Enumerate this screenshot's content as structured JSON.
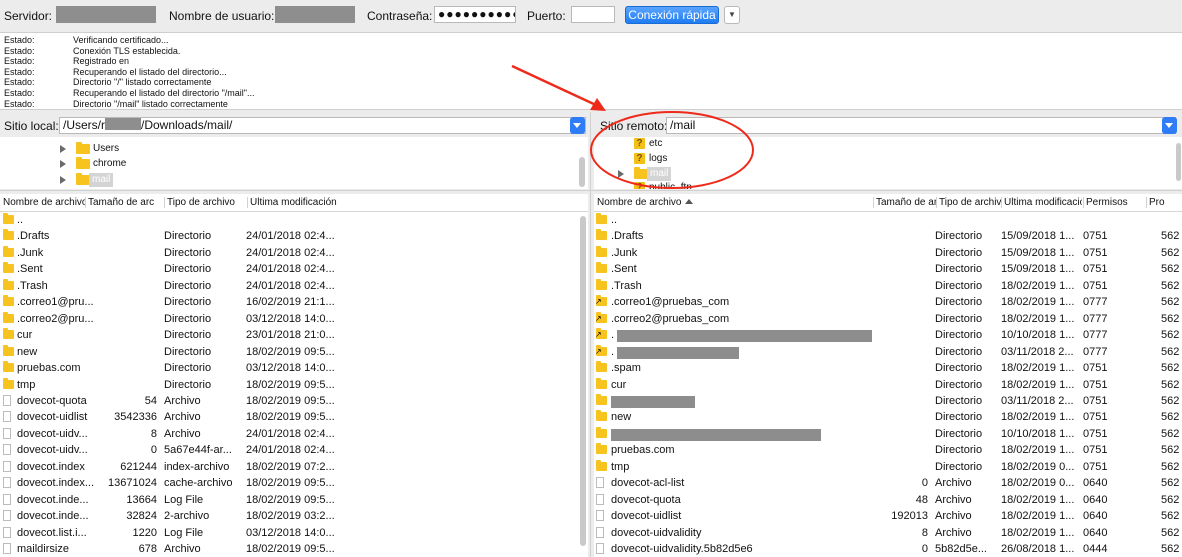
{
  "quickconnect": {
    "server_label": "Servidor:",
    "user_label": "Nombre de usuario:",
    "password_label": "Contraseña:",
    "password_value": "●●●●●●●●●●●",
    "port_label": "Puerto:",
    "port_value": "",
    "connect_button": "Conexión rápida",
    "dropdown_icon": "chevron-down-icon"
  },
  "log": [
    {
      "label": "Estado:",
      "msg": "Verificando certificado..."
    },
    {
      "label": "Estado:",
      "msg": "Conexión TLS establecida."
    },
    {
      "label": "Estado:",
      "msg": "Registrado en"
    },
    {
      "label": "Estado:",
      "msg": "Recuperando el listado del directorio..."
    },
    {
      "label": "Estado:",
      "msg": "Directorio \"/\" listado correctamente"
    },
    {
      "label": "Estado:",
      "msg": "Recuperando el listado del directorio \"/mail\"..."
    },
    {
      "label": "Estado:",
      "msg": "Directorio \"/mail\" listado correctamente"
    }
  ],
  "local": {
    "site_label": "Sitio local:",
    "path_start": "/Users/r",
    "path_end": "/Downloads/mail/",
    "tree": [
      "Users",
      "chrome",
      "mail"
    ],
    "headers": [
      "Nombre de archivo",
      "Tamaño de arc",
      "Tipo de archivo",
      "Última modificación"
    ],
    "rows": [
      {
        "name": "..",
        "size": "",
        "type": "",
        "mod": "",
        "kind": "folder"
      },
      {
        "name": ".Drafts",
        "size": "",
        "type": "Directorio",
        "mod": "24/01/2018 02:4...",
        "kind": "folder"
      },
      {
        "name": ".Junk",
        "size": "",
        "type": "Directorio",
        "mod": "24/01/2018 02:4...",
        "kind": "folder"
      },
      {
        "name": ".Sent",
        "size": "",
        "type": "Directorio",
        "mod": "24/01/2018 02:4...",
        "kind": "folder"
      },
      {
        "name": ".Trash",
        "size": "",
        "type": "Directorio",
        "mod": "24/01/2018 02:4...",
        "kind": "folder"
      },
      {
        "name": ".correo1@pru...",
        "size": "",
        "type": "Directorio",
        "mod": "16/02/2019 21:1...",
        "kind": "folder"
      },
      {
        "name": ".correo2@pru...",
        "size": "",
        "type": "Directorio",
        "mod": "03/12/2018 14:0...",
        "kind": "folder"
      },
      {
        "name": "cur",
        "size": "",
        "type": "Directorio",
        "mod": "23/01/2018 21:0...",
        "kind": "folder"
      },
      {
        "name": "new",
        "size": "",
        "type": "Directorio",
        "mod": "18/02/2019 09:5...",
        "kind": "folder"
      },
      {
        "name": "pruebas.com",
        "size": "",
        "type": "Directorio",
        "mod": "03/12/2018 14:0...",
        "kind": "folder"
      },
      {
        "name": "tmp",
        "size": "",
        "type": "Directorio",
        "mod": "18/02/2019 09:5...",
        "kind": "folder"
      },
      {
        "name": "dovecot-quota",
        "size": "54",
        "type": "Archivo",
        "mod": "18/02/2019 09:5...",
        "kind": "file"
      },
      {
        "name": "dovecot-uidlist",
        "size": "3542336",
        "type": "Archivo",
        "mod": "18/02/2019 09:5...",
        "kind": "file"
      },
      {
        "name": "dovecot-uidv...",
        "size": "8",
        "type": "Archivo",
        "mod": "24/01/2018 02:4...",
        "kind": "file"
      },
      {
        "name": "dovecot-uidv...",
        "size": "0",
        "type": "5a67e44f-ar...",
        "mod": "24/01/2018 02:4...",
        "kind": "file"
      },
      {
        "name": "dovecot.index",
        "size": "621244",
        "type": "index-archivo",
        "mod": "18/02/2019 07:2...",
        "kind": "file"
      },
      {
        "name": "dovecot.index...",
        "size": "13671024",
        "type": "cache-archivo",
        "mod": "18/02/2019 09:5...",
        "kind": "file"
      },
      {
        "name": "dovecot.inde...",
        "size": "13664",
        "type": "Log File",
        "mod": "18/02/2019 09:5...",
        "kind": "file"
      },
      {
        "name": "dovecot.inde...",
        "size": "32824",
        "type": "2-archivo",
        "mod": "18/02/2019 03:2...",
        "kind": "file"
      },
      {
        "name": "dovecot.list.i...",
        "size": "1220",
        "type": "Log File",
        "mod": "03/12/2018 14:0...",
        "kind": "file"
      },
      {
        "name": "maildirsize",
        "size": "678",
        "type": "Archivo",
        "mod": "18/02/2019 09:5...",
        "kind": "file"
      }
    ]
  },
  "remote": {
    "site_label": "Sitio remoto:",
    "path": "/mail",
    "tree": [
      "etc",
      "logs",
      "mail",
      "public_ftp"
    ],
    "headers": [
      "Nombre de archivo",
      "Tamaño de arc",
      "Tipo de archivo",
      "Última modificació",
      "Permisos",
      "Pro"
    ],
    "rows": [
      {
        "name": "..",
        "size": "",
        "type": "",
        "mod": "",
        "perm": "",
        "own": "",
        "kind": "folder"
      },
      {
        "name": ".Drafts",
        "size": "",
        "type": "Directorio",
        "mod": "15/09/2018 1...",
        "perm": "0751",
        "own": "562",
        "kind": "folder"
      },
      {
        "name": ".Junk",
        "size": "",
        "type": "Directorio",
        "mod": "15/09/2018 1...",
        "perm": "0751",
        "own": "562",
        "kind": "folder"
      },
      {
        "name": ".Sent",
        "size": "",
        "type": "Directorio",
        "mod": "15/09/2018 1...",
        "perm": "0751",
        "own": "562",
        "kind": "folder"
      },
      {
        "name": ".Trash",
        "size": "",
        "type": "Directorio",
        "mod": "18/02/2019 1...",
        "perm": "0751",
        "own": "562",
        "kind": "folder"
      },
      {
        "name": ".correo1@pruebas_com",
        "size": "",
        "type": "Directorio",
        "mod": "18/02/2019 1...",
        "perm": "0777",
        "own": "562",
        "kind": "link"
      },
      {
        "name": ".correo2@pruebas_com",
        "size": "",
        "type": "Directorio",
        "mod": "18/02/2019 1...",
        "perm": "0777",
        "own": "562",
        "kind": "link"
      },
      {
        "name": ".",
        "size": "",
        "type": "Directorio",
        "mod": "10/10/2018 1...",
        "perm": "0777",
        "own": "562",
        "kind": "link",
        "redact": 255
      },
      {
        "name": ".",
        "size": "",
        "type": "Directorio",
        "mod": "03/11/2018 2...",
        "perm": "0777",
        "own": "562",
        "kind": "link",
        "redact": 122
      },
      {
        "name": ".spam",
        "size": "",
        "type": "Directorio",
        "mod": "18/02/2019 1...",
        "perm": "0751",
        "own": "562",
        "kind": "folder"
      },
      {
        "name": "cur",
        "size": "",
        "type": "Directorio",
        "mod": "18/02/2019 1...",
        "perm": "0751",
        "own": "562",
        "kind": "folder"
      },
      {
        "name": "",
        "size": "",
        "type": "Directorio",
        "mod": "03/11/2018 2...",
        "perm": "0751",
        "own": "562",
        "kind": "folder",
        "redact": 84
      },
      {
        "name": "new",
        "size": "",
        "type": "Directorio",
        "mod": "18/02/2019 1...",
        "perm": "0751",
        "own": "562",
        "kind": "folder"
      },
      {
        "name": "",
        "size": "",
        "type": "Directorio",
        "mod": "10/10/2018 1...",
        "perm": "0751",
        "own": "562",
        "kind": "folder",
        "redact": 210
      },
      {
        "name": "pruebas.com",
        "size": "",
        "type": "Directorio",
        "mod": "18/02/2019 1...",
        "perm": "0751",
        "own": "562",
        "kind": "folder"
      },
      {
        "name": "tmp",
        "size": "",
        "type": "Directorio",
        "mod": "18/02/2019 0...",
        "perm": "0751",
        "own": "562",
        "kind": "folder"
      },
      {
        "name": "dovecot-acl-list",
        "size": "0",
        "type": "Archivo",
        "mod": "18/02/2019 0...",
        "perm": "0640",
        "own": "562",
        "kind": "file"
      },
      {
        "name": "dovecot-quota",
        "size": "48",
        "type": "Archivo",
        "mod": "18/02/2019 1...",
        "perm": "0640",
        "own": "562",
        "kind": "file"
      },
      {
        "name": "dovecot-uidlist",
        "size": "192013",
        "type": "Archivo",
        "mod": "18/02/2019 1...",
        "perm": "0640",
        "own": "562",
        "kind": "file"
      },
      {
        "name": "dovecot-uidvalidity",
        "size": "8",
        "type": "Archivo",
        "mod": "18/02/2019 1...",
        "perm": "0640",
        "own": "562",
        "kind": "file"
      },
      {
        "name": "dovecot-uidvalidity.5b82d5e6",
        "size": "0",
        "type": "5b82d5e...",
        "mod": "26/08/2018 1...",
        "perm": "0444",
        "own": "562",
        "kind": "file"
      }
    ]
  },
  "annotation": {
    "color": "#ee2a1b"
  }
}
